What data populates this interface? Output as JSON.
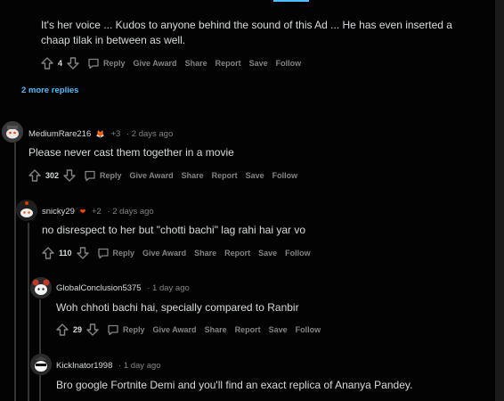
{
  "comments": [
    {
      "body": "It's her voice ... Kudos to anyone behind the sound of this Ad ... He has even inserted a chaap tilak in between as well.",
      "score": "4"
    },
    {
      "username": "MediumRare216",
      "flair": "+3",
      "time": "· 2 days ago",
      "body": "Please never cast them together in a movie",
      "score": "302"
    },
    {
      "username": "snicky29",
      "flair": "+2",
      "time": "· 2 days ago",
      "body": "no disrespect to her but \"chotti bachi\" lag rahi hai yar vo",
      "score": "110"
    },
    {
      "username": "GlobalConclusion5375",
      "time": "· 1 day ago",
      "body": "Woh chhoti bachi hai, specially compared to Ranbir",
      "score": "29"
    },
    {
      "username": "KickInator1998",
      "time": "· 1 day ago",
      "body": "Bro google Fortnite Demi and you'll find an exact replica of Ananya Pandey."
    }
  ],
  "actions": {
    "reply": "Reply",
    "give_award": "Give Award",
    "share": "Share",
    "report": "Report",
    "save": "Save",
    "follow": "Follow"
  },
  "more_replies": "2 more replies",
  "colors": {
    "background": "#030303",
    "text": "#d7dadc",
    "muted": "#818384",
    "link": "#4fbcff",
    "thread": "#343536"
  }
}
